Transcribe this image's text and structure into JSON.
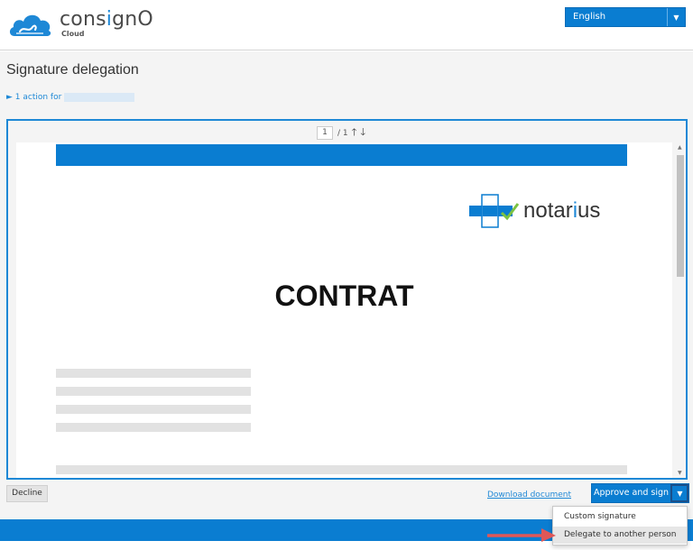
{
  "header": {
    "logo_name_pre": "cons",
    "logo_name_accent": "i",
    "logo_name_post": "gnO",
    "logo_sub": "Cloud",
    "language": "English"
  },
  "page": {
    "title": "Signature delegation",
    "action_text": "► 1 action for"
  },
  "viewer": {
    "current_page": "1",
    "total_pages": "/ 1",
    "up_arrow": "🡑",
    "down_arrow": "🡓",
    "document_heading": "CONTRAT",
    "brand_pre": "notar",
    "brand_accent": "i",
    "brand_post": "us"
  },
  "actions": {
    "decline": "Decline",
    "download": "Download document",
    "approve": "Approve and sign"
  },
  "menu": {
    "items": [
      "Custom signature",
      "Delegate to another person"
    ]
  },
  "colors": {
    "brand_blue": "#0a7dd1",
    "link_blue": "#1e88d6",
    "arrow_red": "#e05757"
  }
}
